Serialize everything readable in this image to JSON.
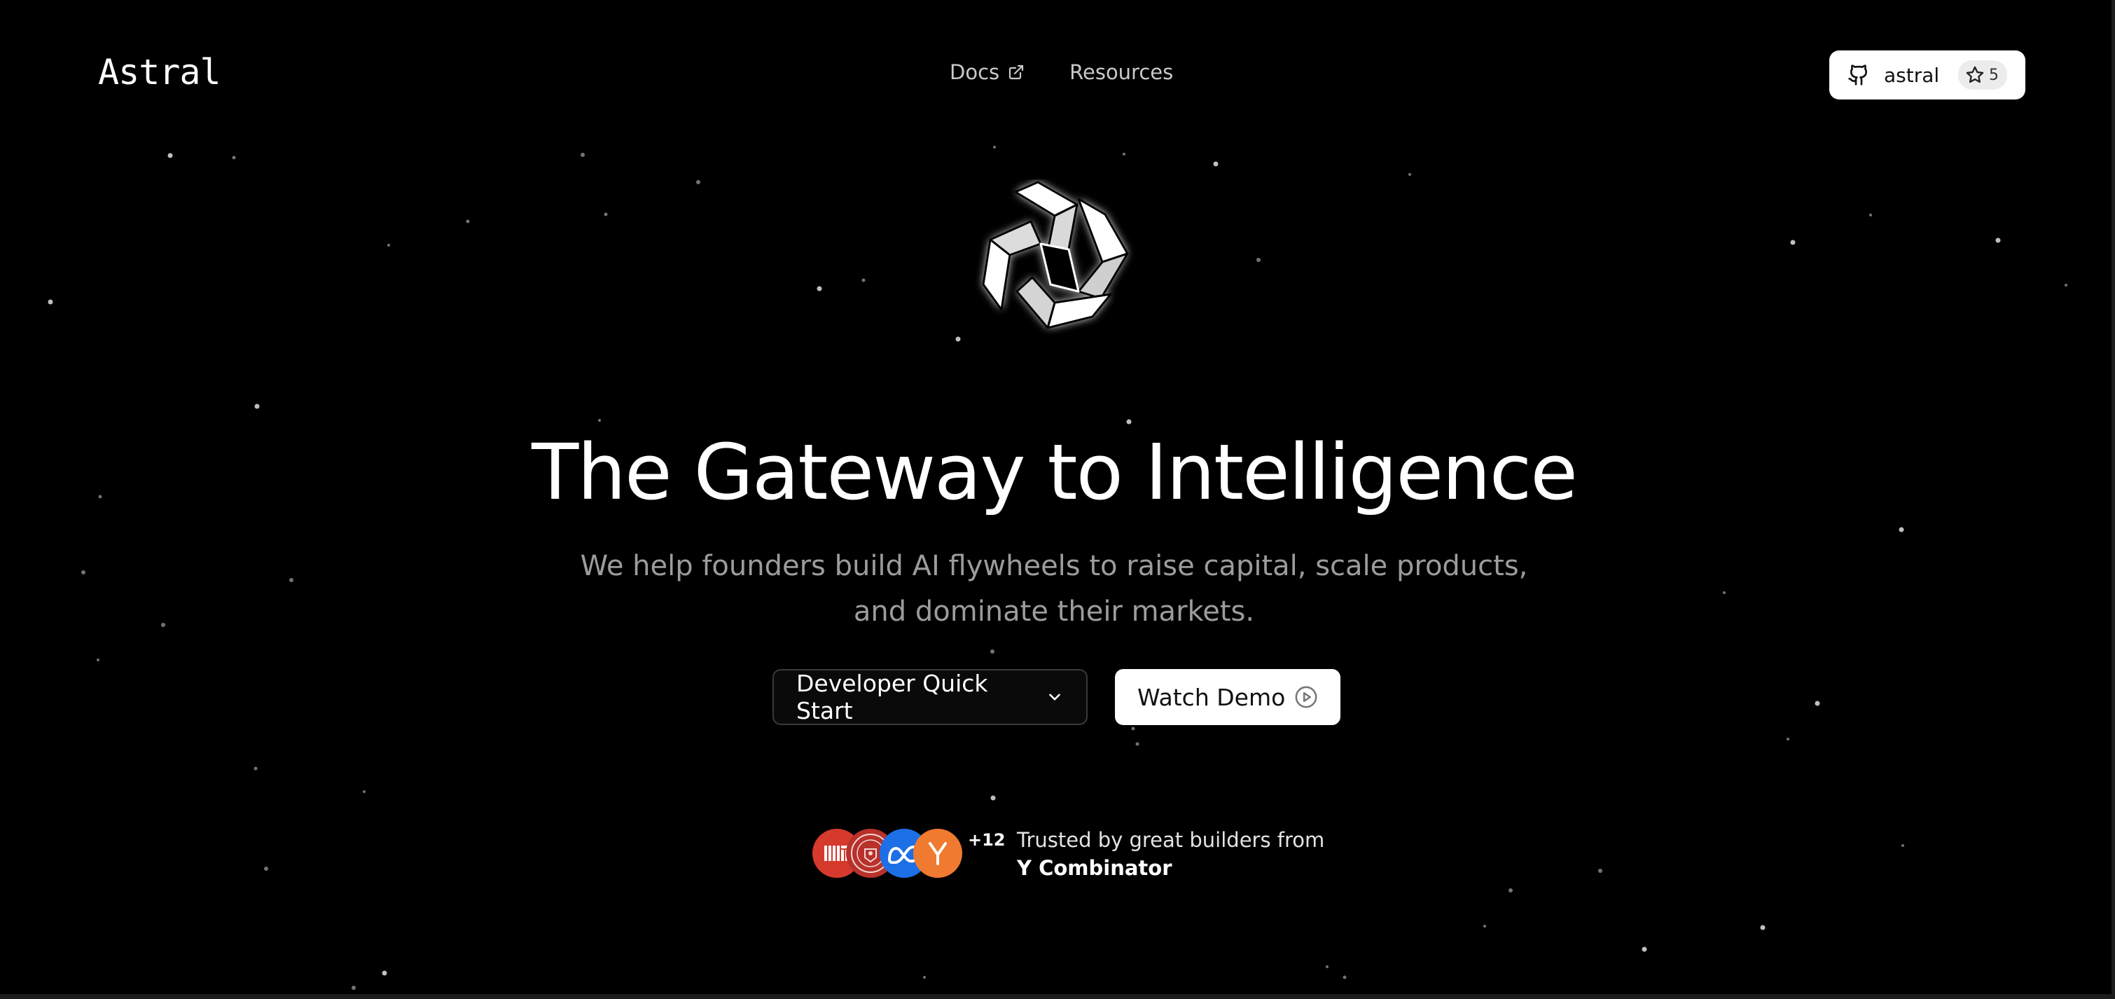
{
  "brand": {
    "logo_text": "Astral"
  },
  "nav": {
    "docs_label": "Docs",
    "resources_label": "Resources"
  },
  "github": {
    "label": "astral",
    "stars": "5",
    "icon": "github-icon"
  },
  "hero": {
    "icon": "astral-mark-icon",
    "headline": "The Gateway to Intelligence",
    "subtitle": "We help founders build AI flywheels to raise capital, scale products, and dominate their markets."
  },
  "actions": {
    "quick_start_label": "Developer Quick Start",
    "watch_demo_label": "Watch Demo"
  },
  "trusted": {
    "logos": [
      "mit-logo",
      "cornell-seal-logo",
      "meta-logo",
      "y-combinator-logo"
    ],
    "plus_count": "+12",
    "line1": "Trusted by great builders from",
    "line2": "Y Combinator"
  },
  "colors": {
    "background": "#000000",
    "primary_text": "#ffffff",
    "muted_text": "#9c9c9c",
    "button_light": "#ffffff",
    "mit_red": "#d63a2c",
    "cornell_red": "#b8312b",
    "meta_blue": "#1d6fe6",
    "yc_orange": "#f07a2f"
  }
}
